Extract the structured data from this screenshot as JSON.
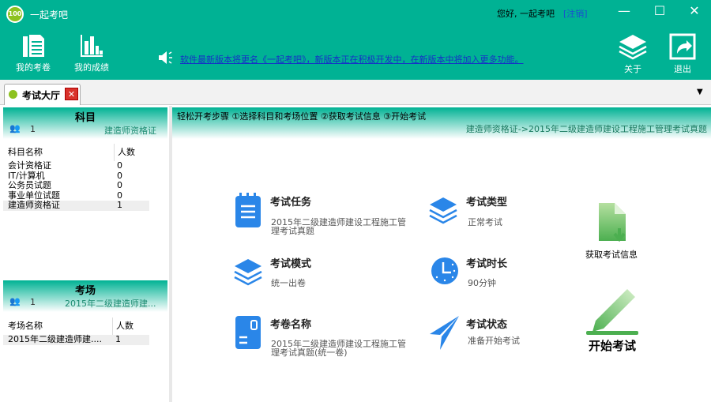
{
  "window": {
    "title": "一起考吧",
    "greeting": "您好, 一起考吧",
    "logout": "[注销]",
    "minimize": "—",
    "maximize": "☐",
    "close": "✕"
  },
  "toolbar": {
    "my_papers": "我的考卷",
    "my_scores": "我的成绩",
    "about": "关于",
    "exit": "退出",
    "notice": "软件最新版本将更名《一起考吧》，新版本正在积极开发中，在新版本中将加入更多功能。"
  },
  "tab": {
    "label": "考试大厅",
    "close": "✕"
  },
  "subjects": {
    "title": "科目",
    "count": "1",
    "selected": "建造师资格证",
    "columns": [
      "科目名称",
      "人数"
    ],
    "rows": [
      {
        "name": "会计资格证",
        "count": "0"
      },
      {
        "name": "IT/计算机",
        "count": "0"
      },
      {
        "name": "公务员试题",
        "count": "0"
      },
      {
        "name": "事业单位试题",
        "count": "0"
      },
      {
        "name": "建造师资格证",
        "count": "1"
      }
    ]
  },
  "venues": {
    "title": "考场",
    "count": "1",
    "selected": "2015年二级建造师建...",
    "columns": [
      "考场名称",
      "人数"
    ],
    "rows": [
      {
        "name": "2015年二级建造师建....",
        "count": "1"
      }
    ]
  },
  "main": {
    "steps": "轻松开考步骤 ①选择科目和考场位置 ②获取考试信息 ③开始考试",
    "path": "建造师资格证->2015年二级建造师建设工程施工管理考试真题",
    "task_title": "考试任务",
    "task_value": "2015年二级建造师建设工程施工管理考试真题",
    "type_title": "考试类型",
    "type_value": "正常考试",
    "mode_title": "考试模式",
    "mode_value": "统一出卷",
    "duration_title": "考试时长",
    "duration_value": "90分钟",
    "paper_title": "考卷名称",
    "paper_value": "2015年二级建造师建设工程施工管理考试真题(统一卷)",
    "status_title": "考试状态",
    "status_value": "准备开始考试",
    "fetch_label": "获取考试信息",
    "start_label": "开始考试"
  }
}
